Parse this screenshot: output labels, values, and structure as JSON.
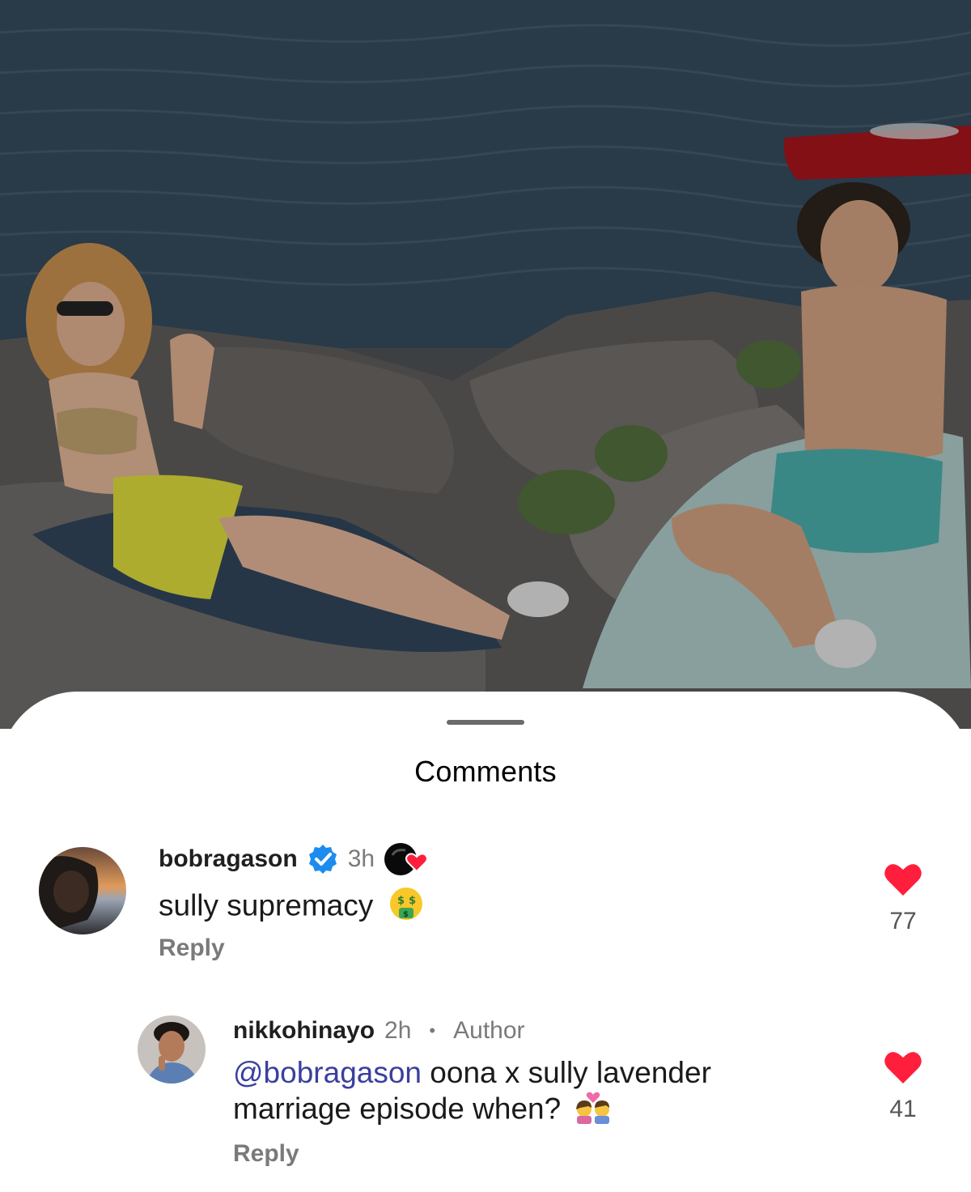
{
  "sheet": {
    "title": "Comments"
  },
  "comments": [
    {
      "username": "bobragason",
      "verified": true,
      "time": "3h",
      "text": "sully supremacy",
      "emoji": "money-mouth-face-emoji",
      "author_liked_badge": true,
      "reply_label": "Reply",
      "like_count": "77",
      "liked": true
    },
    {
      "username": "nikkohinayo",
      "time": "2h",
      "author_label": "Author",
      "mention": "@bobragason",
      "text_line1": " oona x sully lavender",
      "text_line2": "marriage episode when?",
      "emoji": "kiss-couple-emoji",
      "reply_label": "Reply",
      "like_count": "41",
      "liked": true
    }
  ],
  "colors": {
    "like_red": "#ff1f3d",
    "verified_blue": "#1d8cf0",
    "mention": "#3a3f9e"
  }
}
